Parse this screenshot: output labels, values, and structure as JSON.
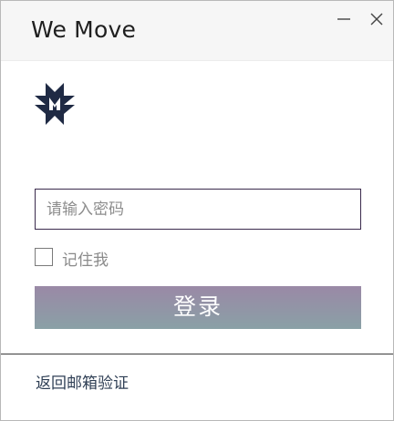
{
  "window": {
    "title": "We Move",
    "controls": {
      "minimize_icon": "minimize-icon",
      "close_icon": "close-icon"
    }
  },
  "logo": {
    "icon": "we-move-logo"
  },
  "form": {
    "password_placeholder": "请输入密码",
    "password_value": "",
    "remember_label": "记住我",
    "remember_checked": false,
    "login_label": "登录"
  },
  "footer": {
    "back_link": "返回邮箱验证"
  },
  "colors": {
    "input_border": "#3a2a4c",
    "button_gradient_top": "#9a89a6",
    "button_gradient_bottom": "#8aa0a6",
    "logo_navy": "#1f2a44"
  }
}
